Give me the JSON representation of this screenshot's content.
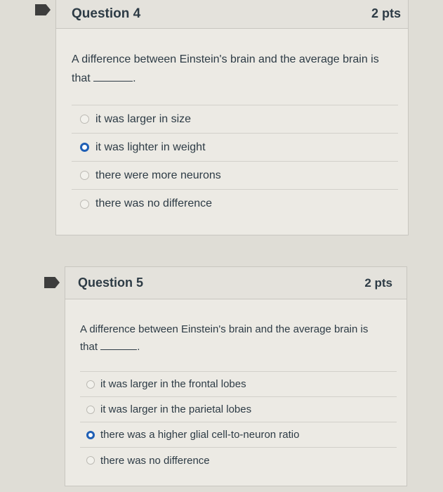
{
  "questions": [
    {
      "title": "Question 4",
      "points": "2 pts",
      "text": "A difference between Einstein's brain and the average brain is",
      "text_end": "that",
      "blank_tail": ".",
      "answers": [
        {
          "label": "it was larger in size",
          "selected": false
        },
        {
          "label": "it was lighter in weight",
          "selected": true
        },
        {
          "label": "there were more neurons",
          "selected": false
        },
        {
          "label": "there was no difference",
          "selected": false
        }
      ]
    },
    {
      "title": "Question 5",
      "points": "2 pts",
      "text": "A difference between Einstein's brain and the average brain is",
      "text_end": "that",
      "blank_tail": ".",
      "answers": [
        {
          "label": "it was larger in the frontal lobes",
          "selected": false
        },
        {
          "label": "it was larger in the parietal lobes",
          "selected": false
        },
        {
          "label": "there was a higher glial cell-to-neuron ratio",
          "selected": true
        },
        {
          "label": "there was no difference",
          "selected": false
        }
      ]
    }
  ],
  "colors": {
    "background": "#dfddd6",
    "card": "#eceae4",
    "header": "#e4e2dc",
    "selected_radio": "#1f5fb5",
    "text": "#2d3b45"
  }
}
